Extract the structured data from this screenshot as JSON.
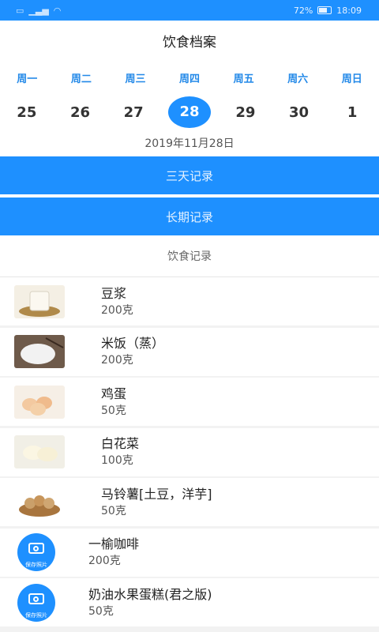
{
  "status": {
    "left": "4G  ",
    "right_battery": "72%",
    "time": "18:09"
  },
  "title": "饮食档案",
  "week": {
    "days": [
      "周一",
      "周二",
      "周三",
      "周四",
      "周五",
      "周六",
      "周日"
    ],
    "dates": [
      "25",
      "26",
      "27",
      "28",
      "29",
      "30",
      "1"
    ],
    "selected": "28"
  },
  "date_text": "2019年11月28日",
  "buttons": {
    "three_day": "三天记录",
    "long_term": "长期记录"
  },
  "section_title": "饮食记录",
  "foods": [
    {
      "name": "豆浆",
      "amount": "200克",
      "icon": "soy-milk-image"
    },
    {
      "name": "米饭（蒸）",
      "amount": "200克",
      "icon": "rice-image"
    },
    {
      "name": "鸡蛋",
      "amount": "50克",
      "icon": "egg-image"
    },
    {
      "name": "白花菜",
      "amount": "100克",
      "icon": "cauliflower-image"
    },
    {
      "name": "马铃薯[土豆，洋芋]",
      "amount": "50克",
      "icon": "potato-image"
    },
    {
      "name": "一榆咖啡",
      "amount": "200克",
      "icon": "camera-icon",
      "camera_text": "保存照片"
    },
    {
      "name": "奶油水果蛋糕(君之版)",
      "amount": "50克",
      "icon": "camera-icon",
      "camera_text": "保存照片"
    }
  ],
  "colors": {
    "accent": "#1e90ff",
    "weekday": "#2389e8"
  }
}
